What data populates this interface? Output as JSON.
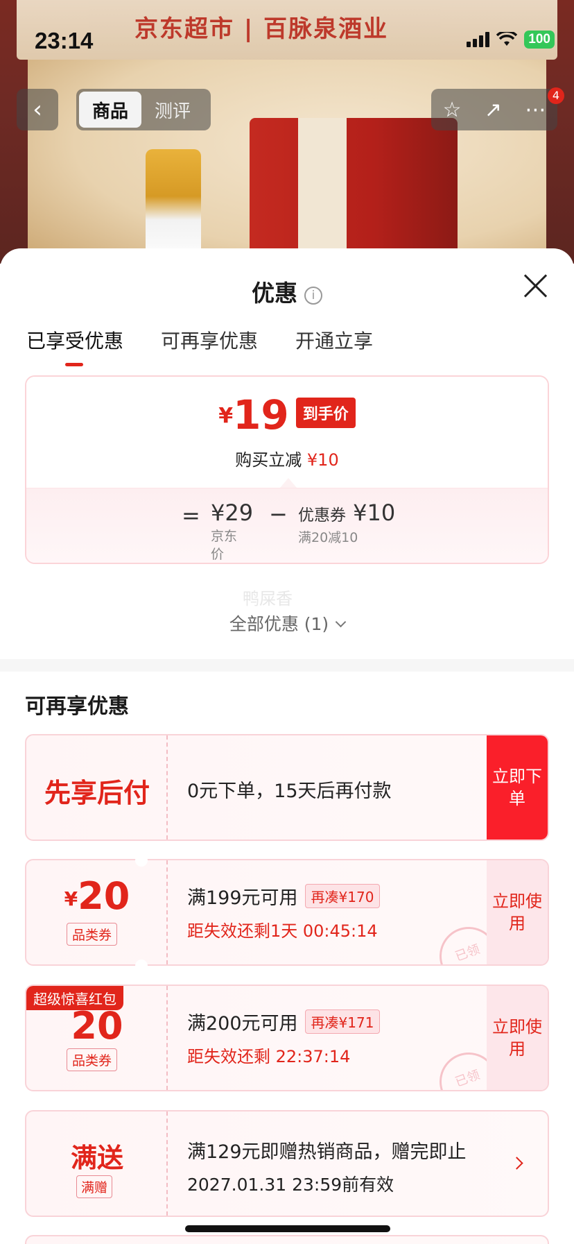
{
  "status_bar": {
    "time": "23:14",
    "battery": "100"
  },
  "header": {
    "banner_text": "京东超市 | 百脉泉酒业",
    "tabs": [
      "商品",
      "测评"
    ],
    "badge": "4"
  },
  "sheet": {
    "title": "优惠",
    "tabs": [
      "已享受优惠",
      "可再享优惠",
      "开通立享"
    ],
    "price": {
      "currency": "¥",
      "final": "19",
      "final_tag": "到手价",
      "reduce_label": "购买立减",
      "reduce_value": "¥10",
      "equals": "=",
      "jd_price": "¥29",
      "jd_price_label": "京东价",
      "minus": "−",
      "coupon_label": "优惠券",
      "coupon_value": "¥10",
      "coupon_condition": "满20减10"
    },
    "watermark": "鸭屎香",
    "all_offers": "全部优惠 (1)",
    "section_title": "可再享优惠",
    "offers": [
      {
        "title": "先享后付",
        "text": "0元下单，15天后再付款",
        "action": "立即下单"
      },
      {
        "currency": "¥",
        "amount": "20",
        "type": "品类券",
        "condition": "满199元可用",
        "pill": "再凑¥170",
        "expire": "距失效还剩1天 00:45:14",
        "action": "立即使用",
        "stamp": "已领"
      },
      {
        "corner": "超级惊喜红包",
        "amount": "20",
        "type": "品类券",
        "condition": "满200元可用",
        "pill": "再凑¥171",
        "expire": "距失效还剩 22:37:14",
        "action": "立即使用",
        "stamp": "已领"
      },
      {
        "title": "满送",
        "tag": "满赠",
        "line1": "满129元即赠热销商品，赠完即止",
        "line2": "2027.01.31 23:59前有效"
      }
    ]
  }
}
